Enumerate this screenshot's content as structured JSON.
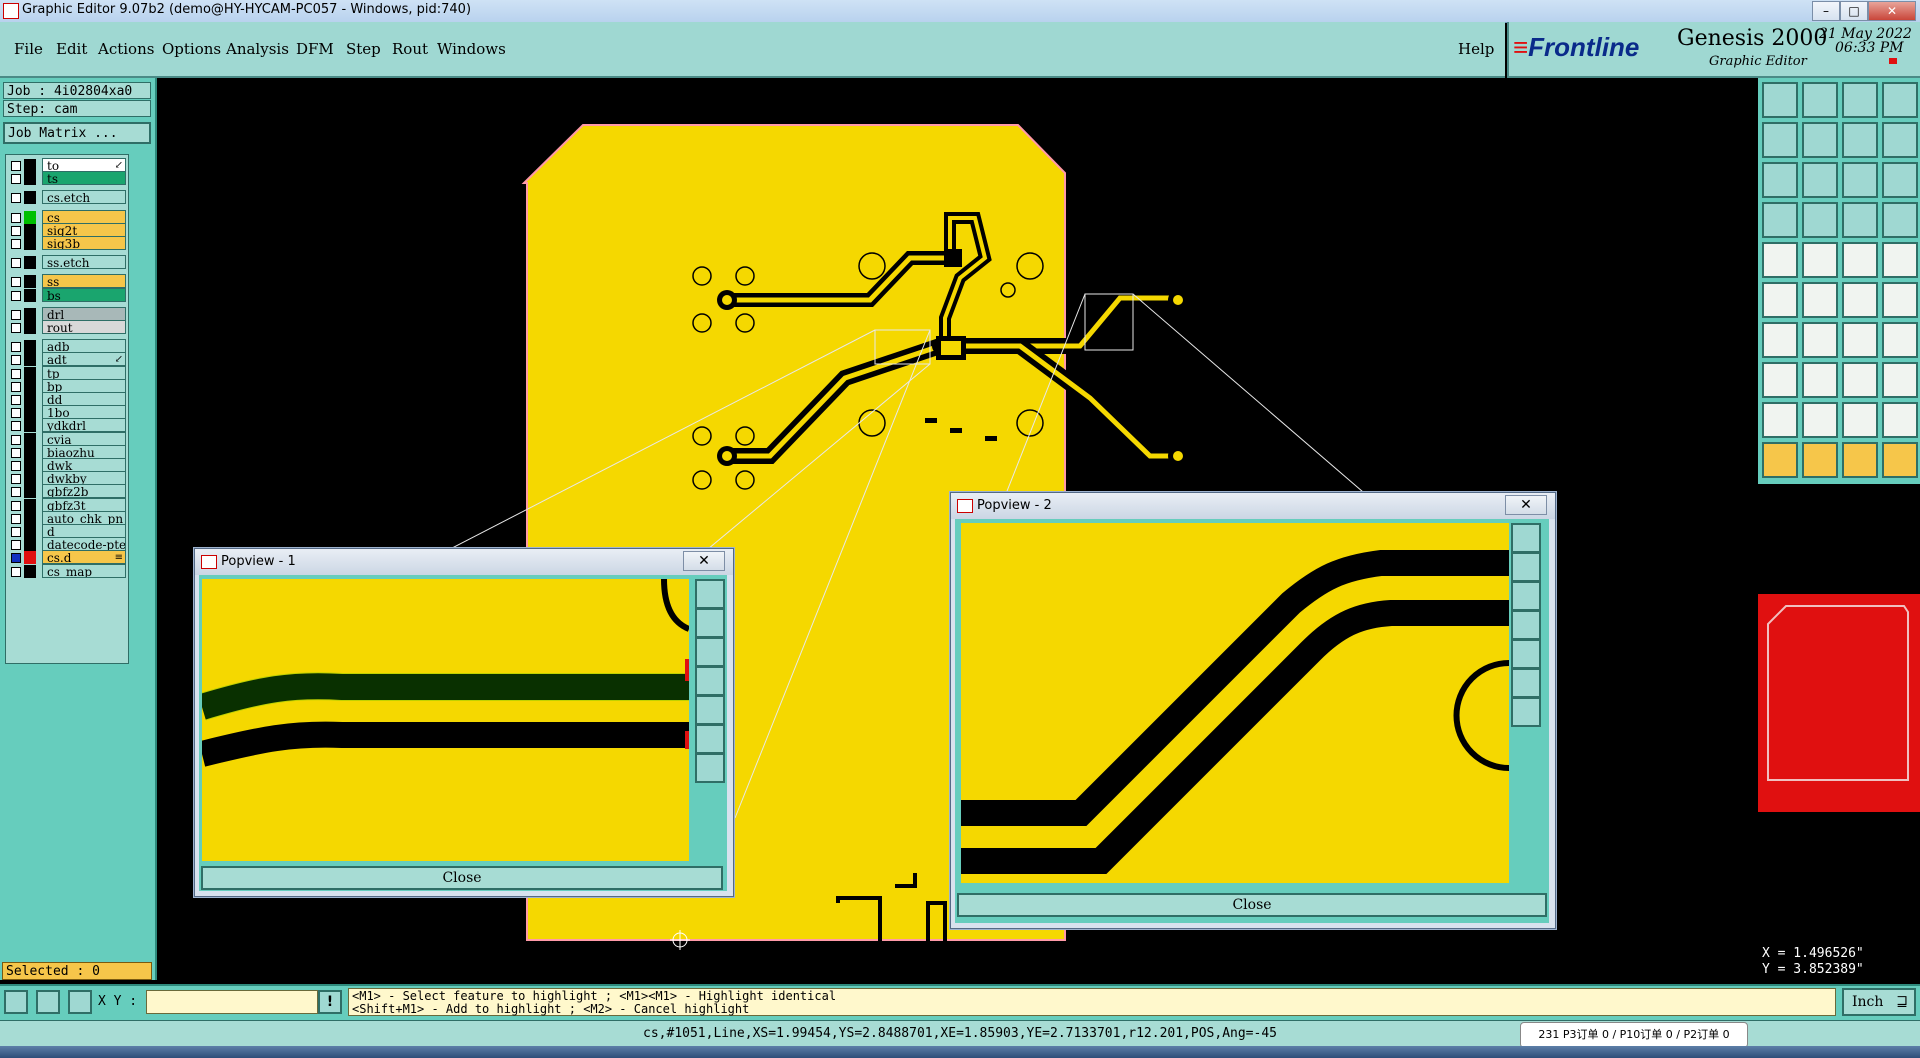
{
  "window": {
    "title": "Graphic Editor 9.07b2 (demo@HY-HYCAM-PC057 - Windows, pid:740)",
    "minimize": "–",
    "maximize": "□",
    "close": "✕"
  },
  "menu": {
    "items": [
      "File",
      "Edit",
      "Actions",
      "Options",
      "Analysis",
      "DFM",
      "Step",
      "Rout",
      "Windows"
    ],
    "help": "Help"
  },
  "brand": {
    "logo": "Frontline",
    "product": "Genesis 2000",
    "subtitle": "Graphic Editor",
    "date": "21 May 2022",
    "time": "06:33 PM"
  },
  "job": {
    "job_label": "Job : 4i02804xa0",
    "step_label": "Step: cam",
    "matrix_button": "Job Matrix ..."
  },
  "layers": [
    {
      "name": "to",
      "bg": "#ffffff",
      "swatch": "#000000",
      "marker": "↙"
    },
    {
      "name": "ts",
      "bg": "#1aa56e",
      "swatch": "#000000",
      "marker": ""
    },
    {
      "name": "cs.etch",
      "bg": "#a7dcd4",
      "swatch": "#000000",
      "marker": ""
    },
    {
      "name": "cs",
      "bg": "#f6c64a",
      "swatch": "#00c000",
      "marker": ""
    },
    {
      "name": "sig2t",
      "bg": "#f6c64a",
      "swatch": "#000000",
      "marker": ""
    },
    {
      "name": "sig3b",
      "bg": "#f6c64a",
      "swatch": "#000000",
      "marker": ""
    },
    {
      "name": "ss.etch",
      "bg": "#a7dcd4",
      "swatch": "#000000",
      "marker": ""
    },
    {
      "name": "ss",
      "bg": "#f6c64a",
      "swatch": "#000000",
      "marker": ""
    },
    {
      "name": "bs",
      "bg": "#1aa56e",
      "swatch": "#000000",
      "marker": ""
    },
    {
      "name": "drl",
      "bg": "#a8b8b8",
      "swatch": "#000000",
      "marker": ""
    },
    {
      "name": "rout",
      "bg": "#d8d8d8",
      "swatch": "#000000",
      "marker": ""
    },
    {
      "name": "adb",
      "bg": "#a7dcd4",
      "swatch": "#000000",
      "marker": ""
    },
    {
      "name": "adt",
      "bg": "#a7dcd4",
      "swatch": "#000000",
      "marker": "↙"
    },
    {
      "name": "tp",
      "bg": "#a7dcd4",
      "swatch": "#000000",
      "marker": ""
    },
    {
      "name": "bp",
      "bg": "#a7dcd4",
      "swatch": "#000000",
      "marker": ""
    },
    {
      "name": "dd",
      "bg": "#a7dcd4",
      "swatch": "#000000",
      "marker": ""
    },
    {
      "name": "1bo",
      "bg": "#a7dcd4",
      "swatch": "#000000",
      "marker": ""
    },
    {
      "name": "ydkdrl",
      "bg": "#a7dcd4",
      "swatch": "#000000",
      "marker": ""
    },
    {
      "name": "cvia",
      "bg": "#a7dcd4",
      "swatch": "#000000",
      "marker": ""
    },
    {
      "name": "biaozhu",
      "bg": "#a7dcd4",
      "swatch": "#000000",
      "marker": ""
    },
    {
      "name": "dwk",
      "bg": "#a7dcd4",
      "swatch": "#000000",
      "marker": ""
    },
    {
      "name": "dwkby",
      "bg": "#a7dcd4",
      "swatch": "#000000",
      "marker": ""
    },
    {
      "name": "gbfz2b",
      "bg": "#a7dcd4",
      "swatch": "#000000",
      "marker": ""
    },
    {
      "name": "gbfz3t",
      "bg": "#a7dcd4",
      "swatch": "#000000",
      "marker": ""
    },
    {
      "name": "auto_chk_pn",
      "bg": "#a7dcd4",
      "swatch": "#000000",
      "marker": ""
    },
    {
      "name": "d",
      "bg": "#a7dcd4",
      "swatch": "#000000",
      "marker": ""
    },
    {
      "name": "datecode-pte",
      "bg": "#a7dcd4",
      "swatch": "#000000",
      "marker": ""
    },
    {
      "name": "cs.d",
      "bg": "#f6c64a",
      "swatch": "#e01010",
      "marker": "≡"
    },
    {
      "name": "cs_map",
      "bg": "#a7dcd4",
      "swatch": "#000000",
      "marker": ""
    }
  ],
  "selected": "Selected : 0",
  "popview1": {
    "title": "Popview - 1",
    "close_x": "✕",
    "close": "Close"
  },
  "popview2": {
    "title": "Popview - 2",
    "close_x": "✕",
    "close": "Close"
  },
  "coords": {
    "x": "X = 1.496526\"",
    "y": "Y = 3.852389\""
  },
  "bottom": {
    "xy_label": "X Y :",
    "xy_value": "",
    "hint1": "<M1> - Select feature to highlight ; <M1><M1> - Highlight identical",
    "hint2": "<Shift+M1> - Add to highlight ; <M2> - Cancel highlight",
    "units": "Inch"
  },
  "status": "cs,#1051,Line,XS=1.99454,YS=2.8488701,XE=1.85903,YE=2.7133701,r12.201,POS,Ang=-45",
  "tooltip": "231 P3订单 0 / P10订单 0 / P2订单 0",
  "colors": {
    "board": "#f5d800",
    "canvas": "#000000",
    "panel": "#66cdbd",
    "accent_red": "#e01010"
  }
}
